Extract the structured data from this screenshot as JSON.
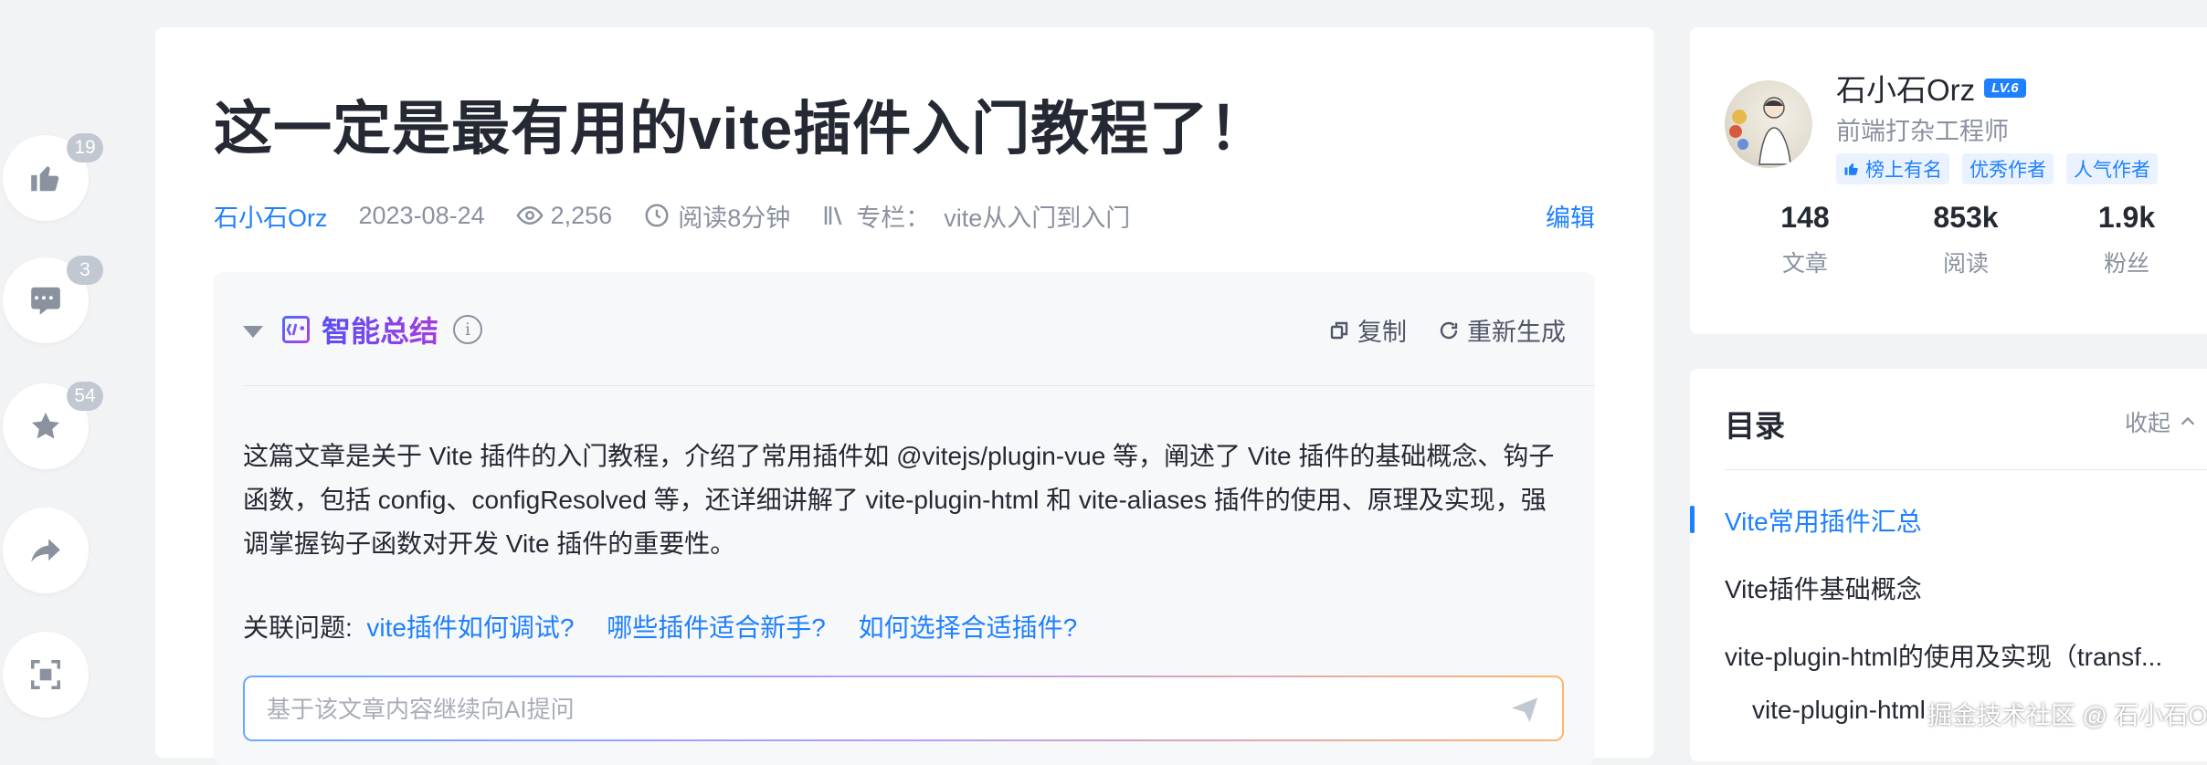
{
  "side_actions": [
    {
      "name": "like",
      "count": "19"
    },
    {
      "name": "comment",
      "count": "3"
    },
    {
      "name": "collect",
      "count": "54"
    },
    {
      "name": "share",
      "count": ""
    },
    {
      "name": "focus",
      "count": ""
    }
  ],
  "article": {
    "title": "这一定是最有用的vite插件入门教程了！",
    "author": "石小石Orz",
    "date": "2023-08-24",
    "views": "2,256",
    "read_time": "阅读8分钟",
    "column_label": "专栏：",
    "column_name": "vite从入门到入门",
    "edit_label": "编辑"
  },
  "summary": {
    "title": "智能总结",
    "info_glyph": "i",
    "copy_label": "复制",
    "regen_label": "重新生成",
    "text": "这篇文章是关于 Vite 插件的入门教程，介绍了常用插件如 @vitejs/plugin-vue 等，阐述了 Vite 插件的基础概念、钩子函数，包括 config、configResolved 等，还详细讲解了 vite-plugin-html 和 vite-aliases 插件的使用、原理及实现，强调掌握钩子函数对开发 Vite 插件的重要性。",
    "related_label": "关联问题:",
    "related": [
      "vite插件如何调试?",
      "哪些插件适合新手?",
      "如何选择合适插件?"
    ],
    "ask_placeholder": "基于该文章内容继续向AI提问"
  },
  "author_card": {
    "name": "石小石Orz",
    "level": "LV.6",
    "job": "前端打杂工程师",
    "tags": [
      "榜上有名",
      "优秀作者",
      "人气作者"
    ],
    "stats": [
      {
        "value": "148",
        "label": "文章"
      },
      {
        "value": "853k",
        "label": "阅读"
      },
      {
        "value": "1.9k",
        "label": "粉丝"
      }
    ]
  },
  "toc": {
    "title": "目录",
    "fold_label": "收起",
    "items": [
      {
        "label": "Vite常用插件汇总",
        "active": true,
        "level": 1
      },
      {
        "label": "Vite插件基础概念",
        "active": false,
        "level": 1
      },
      {
        "label": "vite-plugin-html的使用及实现（transf...",
        "active": false,
        "level": 1
      },
      {
        "label": "vite-plugin-html",
        "active": false,
        "level": 2
      }
    ]
  },
  "watermark": "掘金技术社区 @ 石小石Orz",
  "colors": {
    "accent": "#1e80ff",
    "ai_purple": "#7a3ef0",
    "text": "#252933",
    "muted": "#8a919f",
    "bg": "#f2f3f5"
  }
}
